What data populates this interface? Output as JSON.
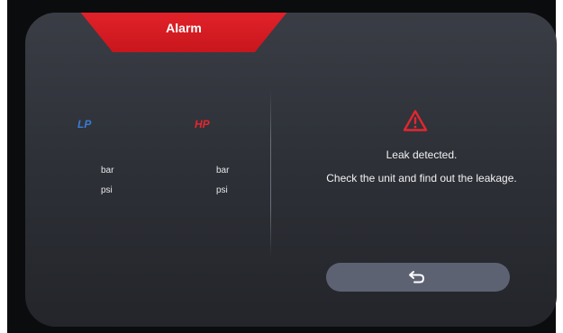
{
  "header": {
    "title": "Alarm"
  },
  "gauges": {
    "lp": {
      "label": "LP",
      "unit_bar": "bar",
      "unit_psi": "psi"
    },
    "hp": {
      "label": "HP",
      "unit_bar": "bar",
      "unit_psi": "psi"
    }
  },
  "alarm": {
    "icon": "warning-triangle-icon",
    "message_line1": "Leak detected.",
    "message_line2": "Check the unit and find out the leakage."
  },
  "actions": {
    "back_icon": "return-arrow-icon"
  },
  "colors": {
    "alarm_red": "#e3222a",
    "lp_blue": "#3a7bd5",
    "hp_red": "#e5262e",
    "button": "#5d6273",
    "panel": "#2e3138"
  }
}
